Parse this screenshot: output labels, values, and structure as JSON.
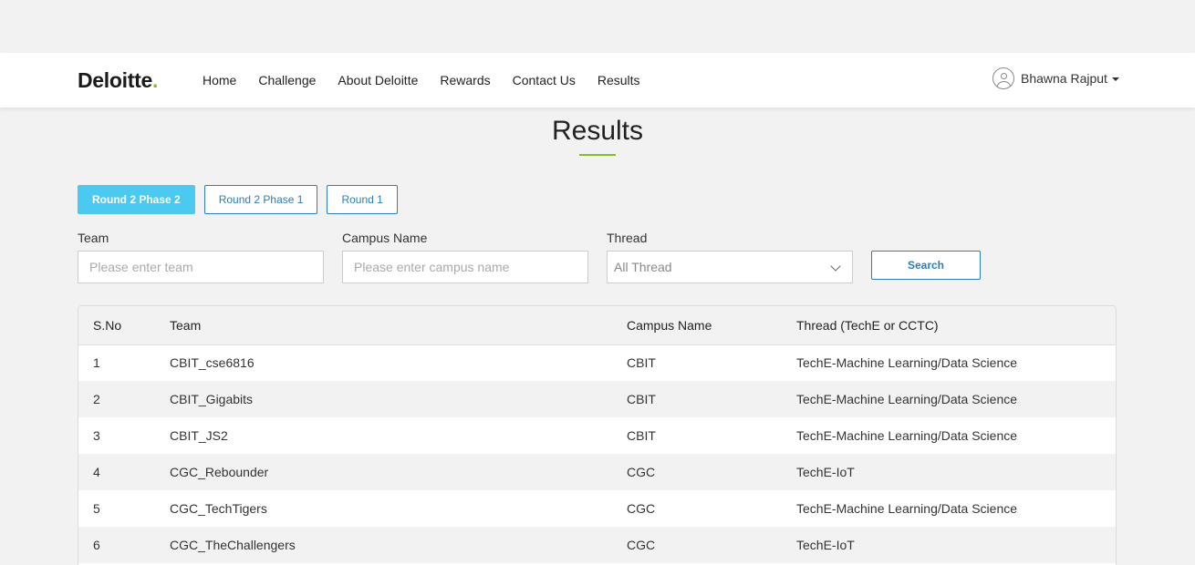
{
  "header": {
    "logo_text": "Deloitte",
    "logo_dot": ".",
    "nav": [
      {
        "label": "Home"
      },
      {
        "label": "Challenge"
      },
      {
        "label": "About Deloitte"
      },
      {
        "label": "Rewards"
      },
      {
        "label": "Contact Us"
      },
      {
        "label": "Results"
      }
    ],
    "user_name": "Bhawna Rajput"
  },
  "page_title": "Results",
  "tabs": [
    {
      "label": "Round 2 Phase 2",
      "active": true
    },
    {
      "label": "Round 2 Phase 1",
      "active": false
    },
    {
      "label": "Round 1",
      "active": false
    }
  ],
  "filters": {
    "team_label": "Team",
    "team_placeholder": "Please enter team",
    "campus_label": "Campus Name",
    "campus_placeholder": "Please enter campus name",
    "thread_label": "Thread",
    "thread_selected": "All Thread",
    "search_label": "Search"
  },
  "table": {
    "headers": [
      "S.No",
      "Team",
      "Campus Name",
      "Thread (TechE or CCTC)"
    ],
    "rows": [
      [
        "1",
        "CBIT_cse6816",
        "CBIT",
        "TechE-Machine Learning/Data Science"
      ],
      [
        "2",
        "CBIT_Gigabits",
        "CBIT",
        "TechE-Machine Learning/Data Science"
      ],
      [
        "3",
        "CBIT_JS2",
        "CBIT",
        "TechE-Machine Learning/Data Science"
      ],
      [
        "4",
        "CGC_Rebounder",
        "CGC",
        "TechE-IoT"
      ],
      [
        "5",
        "CGC_TechTigers",
        "CGC",
        "TechE-Machine Learning/Data Science"
      ],
      [
        "6",
        "CGC_TheChallengers",
        "CGC",
        "TechE-IoT"
      ]
    ]
  },
  "colors": {
    "brand_green": "#86bc25",
    "active_tab": "#4cc9f0",
    "link_blue": "#2a7fb8"
  }
}
